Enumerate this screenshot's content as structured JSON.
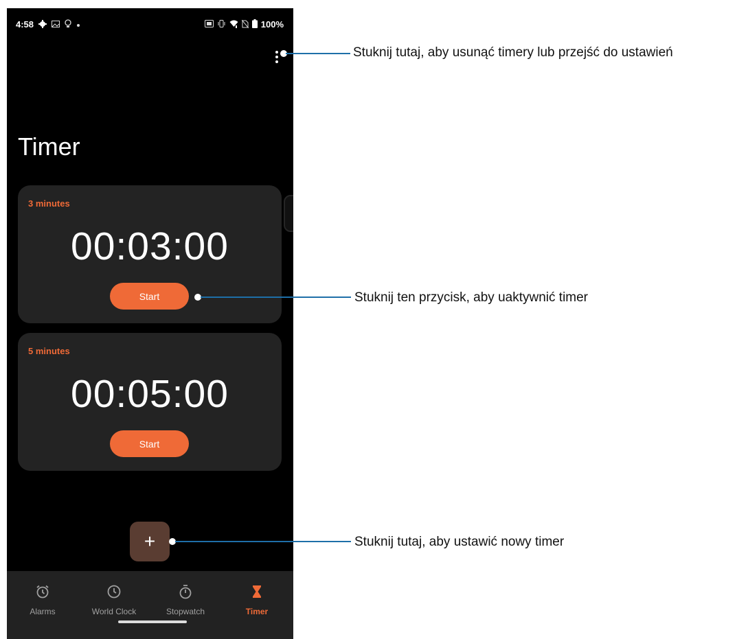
{
  "status_bar": {
    "time": "4:58",
    "left_icons": [
      "gear-icon",
      "image-icon",
      "bulb-icon",
      "dot-icon"
    ],
    "right_icons": [
      "nfc-icon",
      "vibrate-icon",
      "wifi-icon",
      "no-sim-icon",
      "battery-icon"
    ],
    "battery": "100%"
  },
  "page": {
    "title": "Timer"
  },
  "timers": [
    {
      "label": "3 minutes",
      "time": "00:03:00",
      "button_label": "Start"
    },
    {
      "label": "5 minutes",
      "time": "00:05:00",
      "button_label": "Start"
    }
  ],
  "fab": {
    "label": "+"
  },
  "bottom_nav": {
    "items": [
      {
        "label": "Alarms",
        "icon": "alarm-icon"
      },
      {
        "label": "World Clock",
        "icon": "clock-icon"
      },
      {
        "label": "Stopwatch",
        "icon": "stopwatch-icon"
      },
      {
        "label": "Timer",
        "icon": "hourglass-icon",
        "active": true
      }
    ]
  },
  "annotations": {
    "menu": "Stuknij tutaj, aby usunąć timery lub przejść do ustawień",
    "start": "Stuknij ten przycisk, aby uaktywnić timer",
    "add": "Stuknij tutaj, aby ustawić nowy timer"
  },
  "colors": {
    "accent": "#ef6a37",
    "callout_line": "#1e6fa8",
    "background": "#000000",
    "card": "#232323",
    "fab": "#5a3d32"
  }
}
